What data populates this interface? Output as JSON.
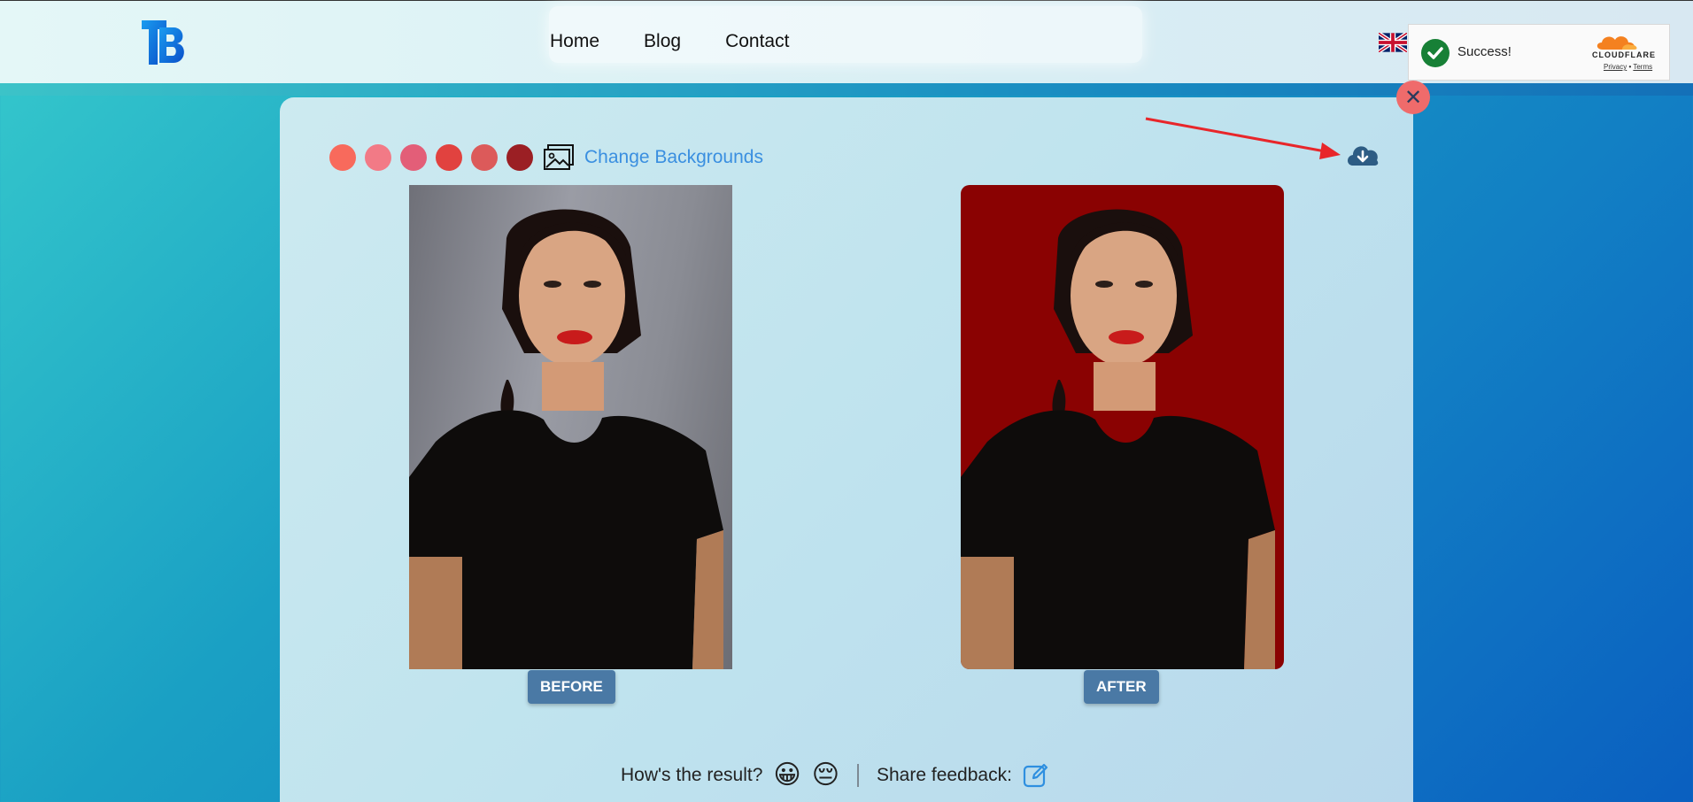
{
  "header": {
    "nav": [
      "Home",
      "Blog",
      "Contact"
    ]
  },
  "captcha": {
    "status": "Success!",
    "brand": "CLOUDFLARE",
    "privacy": "Privacy",
    "separator": "•",
    "terms": "Terms"
  },
  "editor": {
    "swatches": [
      "#f86a5c",
      "#f27a86",
      "#e35e78",
      "#e1423f",
      "#dc5a5a",
      "#9b1f24"
    ],
    "change_backgrounds": "Change Backgrounds",
    "before_label": "BEFORE",
    "after_label": "AFTER",
    "after_background": "#8a0202"
  },
  "feedback": {
    "question": "How's the result?",
    "happy": "😀",
    "sad": "😔",
    "share": "Share feedback:"
  }
}
